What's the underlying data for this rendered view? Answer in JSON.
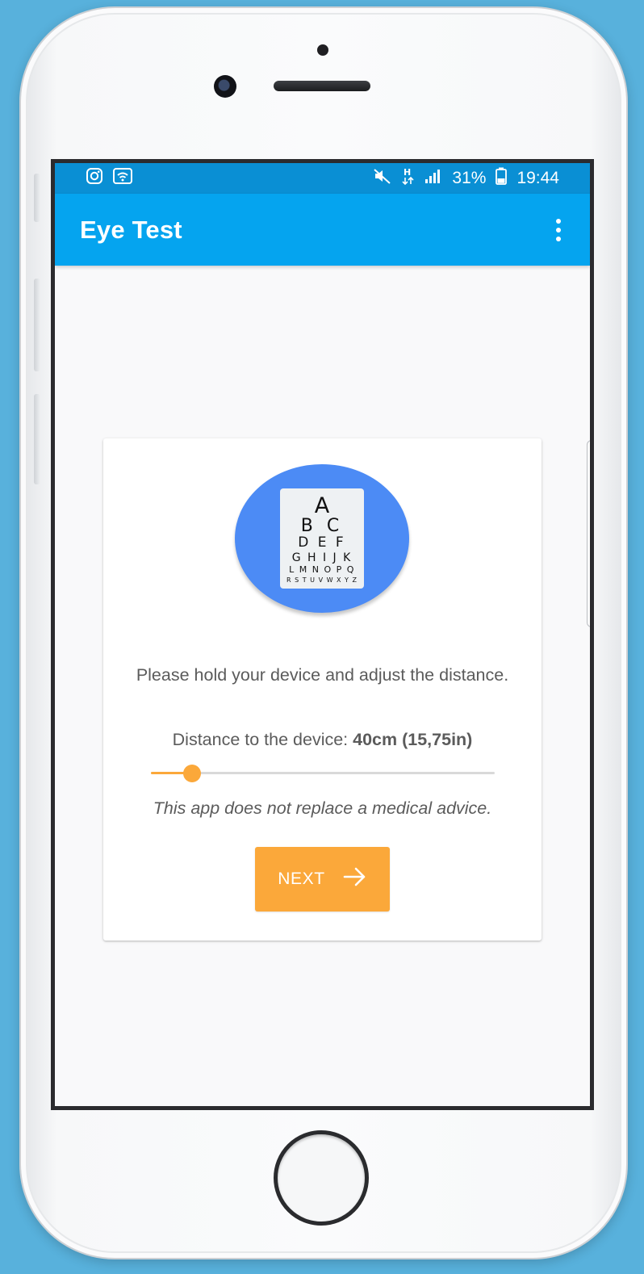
{
  "status_bar": {
    "battery": "31%",
    "time": "19:44",
    "left_icons": [
      "instagram-icon",
      "wifi-calling-icon"
    ],
    "right_icons": [
      "mute-icon",
      "h-plus-data-icon",
      "signal-icon",
      "battery-icon"
    ]
  },
  "app_bar": {
    "title": "Eye Test",
    "menu_icon": "more-vert-icon"
  },
  "logo": {
    "chart_rows": [
      "A",
      "B C",
      "D E F",
      "G H I J K",
      "L M N O P Q",
      "R S T U V W X Y Z"
    ]
  },
  "main": {
    "instruction": "Please hold your device and adjust the distance.",
    "distance_label": "Distance to the device:",
    "distance_value": "40cm (15,75in)",
    "slider_fraction": 0.12,
    "disclaimer": "This app does not replace a medical advice.",
    "next_button": "NEXT"
  },
  "colors": {
    "status_bar": "#0a8fd4",
    "app_bar": "#05a4ef",
    "accent": "#fba83a",
    "logo_circle": "#4c8bf5",
    "background": "#58b1dc"
  }
}
